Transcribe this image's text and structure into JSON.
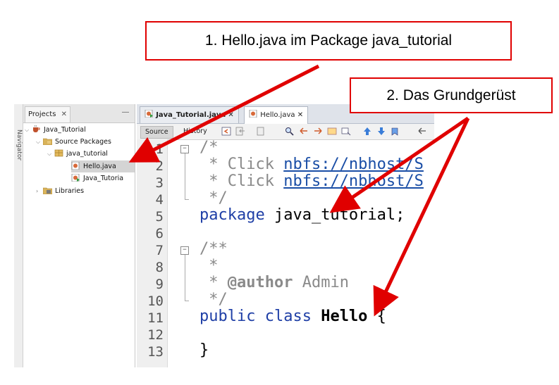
{
  "side_strip": {
    "label": "Navigator"
  },
  "projects": {
    "tab_label": "Projects",
    "close": "✕",
    "minimize": "—",
    "tree": [
      {
        "label": "Java_Tutorial",
        "icon": "coffee-cup-project-icon"
      },
      {
        "label": "Source Packages",
        "icon": "folder-source-icon"
      },
      {
        "label": "java_tutorial",
        "icon": "package-icon"
      },
      {
        "label": "Hello.java",
        "icon": "java-file-icon",
        "selected": true
      },
      {
        "label": "Java_Tutoria",
        "icon": "java-main-file-icon"
      },
      {
        "label": "Libraries",
        "icon": "libraries-icon"
      }
    ]
  },
  "editor": {
    "tabs": [
      {
        "label": "Java_Tutorial.java",
        "close": "✕",
        "active": false
      },
      {
        "label": "Hello.java",
        "close": "✕",
        "active": true
      }
    ],
    "toolbar": {
      "source": "Source",
      "history": "History"
    },
    "lines": {
      "l1": {
        "n": "1",
        "comment": "/*"
      },
      "l2": {
        "n": "2",
        "prefix": " * Click ",
        "link": "nbfs://nbhost/S"
      },
      "l3": {
        "n": "3",
        "prefix": " * Click ",
        "link": "nbfs://nbhost/S"
      },
      "l4": {
        "n": "4",
        "comment": " */"
      },
      "l5": {
        "n": "5",
        "kw": "package",
        "rest": " java_tutorial;"
      },
      "l6": {
        "n": "6"
      },
      "l7": {
        "n": "7",
        "comment": "/**"
      },
      "l8": {
        "n": "8",
        "comment": " *"
      },
      "l9": {
        "n": "9",
        "prefix": " * ",
        "tag": "@author",
        "rest": " Admin"
      },
      "l10": {
        "n": "10",
        "comment": " */"
      },
      "l11": {
        "n": "11",
        "kw": "public class",
        "cls": "Hello",
        "rest": " {"
      },
      "l12": {
        "n": "12"
      },
      "l13": {
        "n": "13",
        "code": "}"
      }
    }
  },
  "callouts": {
    "c1": "1. Hello.java im Package java_tutorial",
    "c2": "2. Das Grundgerüst"
  },
  "colors": {
    "callout_red": "#e00000",
    "keyword": "#1f3fa6",
    "comment": "#8a8a8a"
  }
}
